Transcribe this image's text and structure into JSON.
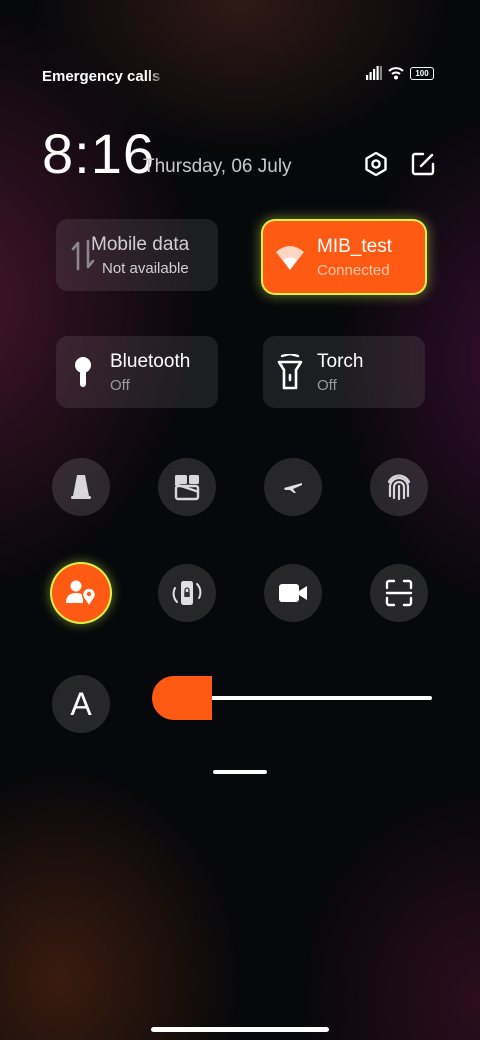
{
  "status": {
    "text": "Emergency calls only",
    "battery": "100"
  },
  "lockscreen": {
    "time": "8:16",
    "date": "Thursday, 06 July"
  },
  "tiles": {
    "mobile_data": {
      "title": "Mobile data",
      "subtitle": "Not available"
    },
    "wifi": {
      "title": "MIB_test",
      "subtitle": "Connected"
    },
    "bluetooth": {
      "title": "Bluetooth",
      "subtitle": "Off"
    },
    "torch": {
      "title": "Torch",
      "subtitle": "Off"
    }
  },
  "toggles": {
    "row1": [
      "bell-icon",
      "screenshot-icon",
      "airplane-icon",
      "fingerprint-icon"
    ],
    "row2": [
      "location-icon",
      "rotation-lock-icon",
      "video-camera-icon",
      "scan-icon"
    ]
  },
  "brightness": {
    "auto_label": "A",
    "level": 0.2
  },
  "colors": {
    "accent": "#ff5a14",
    "highlight": "#d7f24a"
  }
}
